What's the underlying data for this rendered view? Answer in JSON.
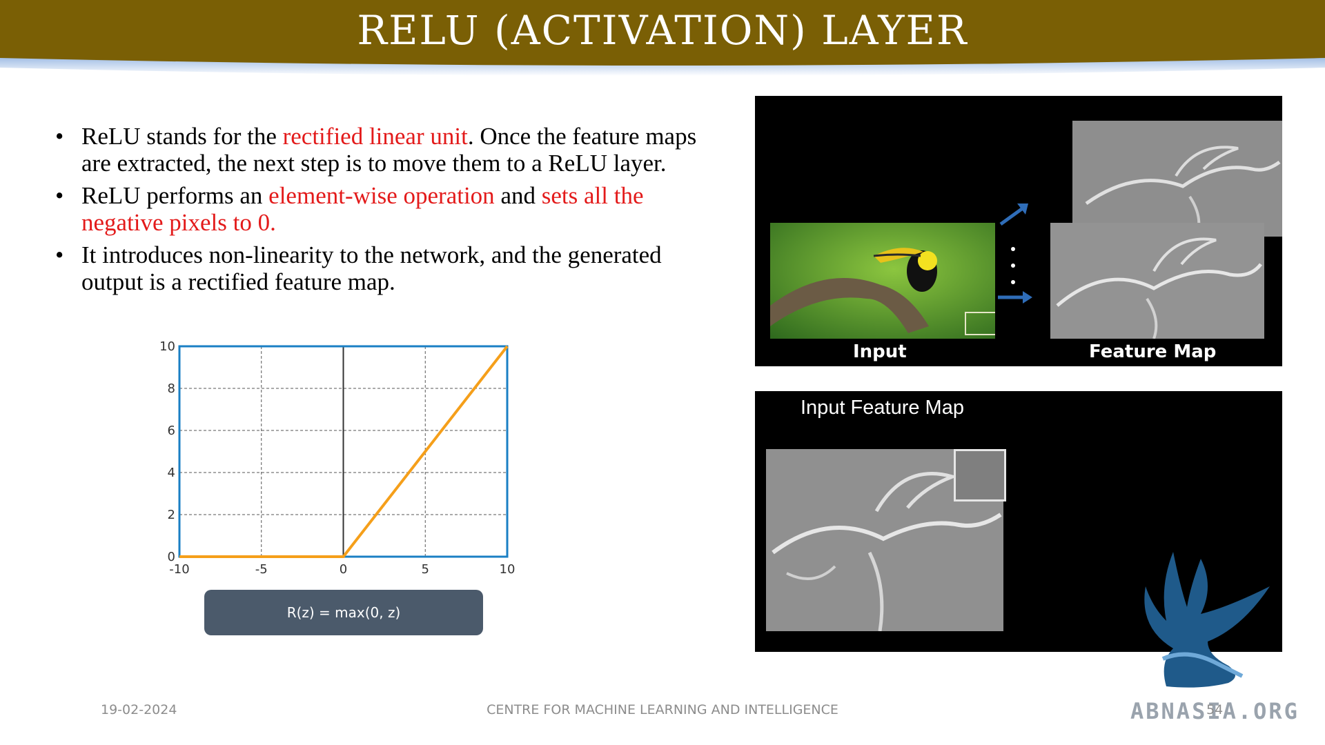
{
  "header": {
    "title": "RELU (ACTIVATION) LAYER"
  },
  "bullets": [
    {
      "parts": [
        {
          "text": "ReLU stands for the ",
          "highlight": false
        },
        {
          "text": "rectified linear unit",
          "highlight": true
        },
        {
          "text": ". Once the feature maps are extracted, the next step is to move them to a ReLU layer.",
          "highlight": false
        }
      ]
    },
    {
      "parts": [
        {
          "text": "ReLU performs an ",
          "highlight": false
        },
        {
          "text": "element-wise operation",
          "highlight": true
        },
        {
          "text": " and ",
          "highlight": false
        },
        {
          "text": "sets all the negative pixels to 0.",
          "highlight": true
        }
      ]
    },
    {
      "parts": [
        {
          "text": "It introduces non-linearity to the network, and the generated output is a rectified feature map.",
          "highlight": false
        }
      ]
    }
  ],
  "chart_data": {
    "type": "line",
    "x": [
      -10,
      0,
      10
    ],
    "series": [
      {
        "values": [
          0,
          0,
          10
        ],
        "color": "#f59f1a"
      }
    ],
    "xticks": [
      "-10",
      "-5",
      "0",
      "5",
      "10"
    ],
    "yticks": [
      "0",
      "2",
      "4",
      "6",
      "8",
      "10"
    ],
    "xlim": [
      -10,
      10
    ],
    "ylim": [
      0,
      10
    ],
    "grid": "dashed",
    "frame_color": "#1a7fc4",
    "zero_line_color": "#333333"
  },
  "formula": "R(z) = max(0, z)",
  "images": {
    "top_input_label": "Input",
    "top_feature_label": "Feature Map",
    "bottom_title": "Input Feature Map"
  },
  "logo": {
    "text": "ABNASIA.ORG",
    "color": "#1f5a8a"
  },
  "footer": {
    "date": "19-02-2024",
    "center": "CENTRE FOR MACHINE LEARNING AND INTELLIGENCE",
    "page": "54"
  },
  "colors": {
    "banner": "#7a5f05",
    "highlight": "#e31a1a"
  }
}
